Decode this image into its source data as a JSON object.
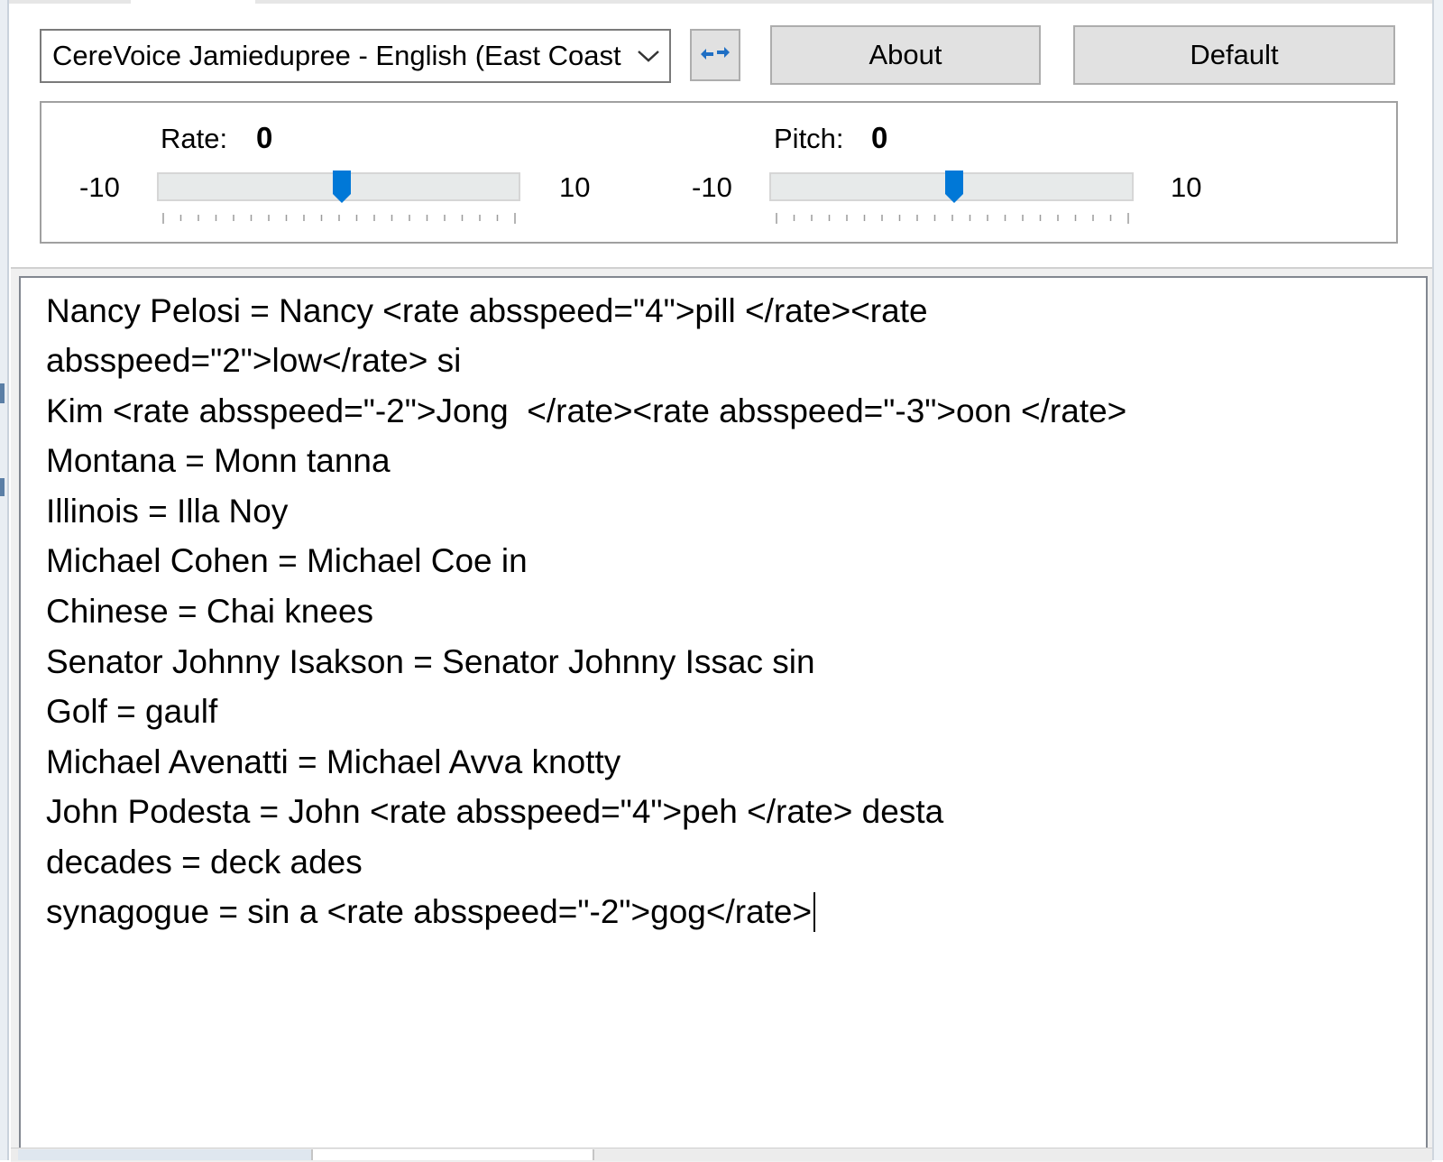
{
  "voice": {
    "selected": "CereVoice Jamiedupree - English (East Coast"
  },
  "buttons": {
    "about": "About",
    "default": "Default"
  },
  "rate": {
    "label": "Rate:",
    "value": "0",
    "min": "-10",
    "max": "10",
    "level": 0
  },
  "pitch": {
    "label": "Pitch:",
    "value": "0",
    "min": "-10",
    "max": "10",
    "level": 0
  },
  "editor": {
    "lines": [
      "Nancy Pelosi = Nancy <rate absspeed=\"4\">pill </rate><rate",
      "absspeed=\"2\">low</rate> si",
      "Kim <rate absspeed=\"-2\">Jong  </rate><rate absspeed=\"-3\">oon </rate>",
      "Montana = Monn tanna",
      "Illinois = Illa Noy",
      "Michael Cohen = Michael Coe in",
      "Chinese = Chai knees",
      "Senator Johnny Isakson = Senator Johnny Issac sin",
      "Golf = gaulf",
      "Michael Avenatti = Michael Avva knotty",
      "John Podesta = John <rate absspeed=\"4\">peh </rate> desta",
      "decades = deck ades",
      "synagogue = sin a <rate absspeed=\"-2\">gog</rate>"
    ]
  },
  "colors": {
    "accent": "#0078d7",
    "button_face": "#e1e1e1",
    "track": "#e7eaea"
  },
  "icons": {
    "dropdown": "chevron-down-icon",
    "refresh": "refresh-icon"
  }
}
